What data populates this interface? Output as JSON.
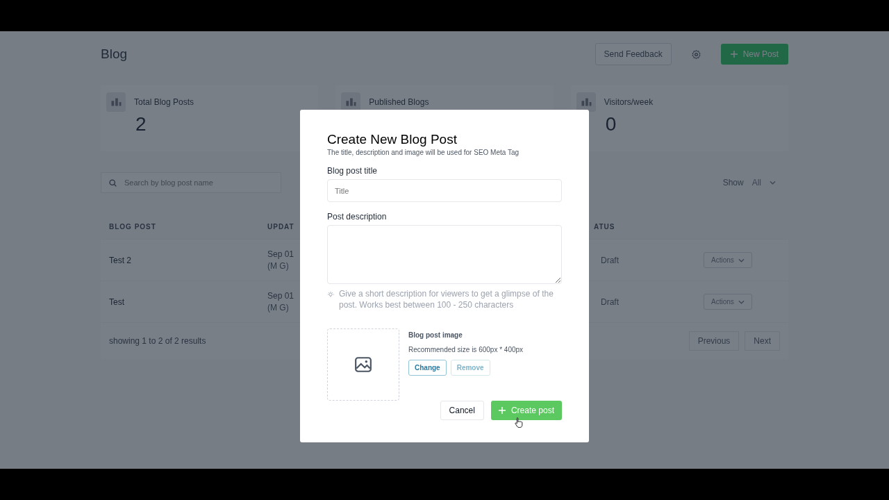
{
  "header": {
    "title": "Blog",
    "feedback_button": "Send Feedback",
    "new_post_button": "New Post"
  },
  "stats": [
    {
      "label": "Total Blog Posts",
      "value": "2"
    },
    {
      "label": "Published Blogs"
    },
    {
      "label": "Visitors/week",
      "value": "0"
    }
  ],
  "search": {
    "placeholder": "Search by blog post name"
  },
  "filter": {
    "label": "Show",
    "value": "All"
  },
  "table": {
    "columns": [
      "BLOG POST",
      "UPDAT",
      "ATUS"
    ],
    "rows": [
      {
        "name": "Test 2",
        "updated": "Sep 01",
        "author": "(M G)",
        "status": "Draft",
        "action": "Actions"
      },
      {
        "name": "Test",
        "updated": "Sep 01",
        "author": "(M G)",
        "status": "Draft",
        "action": "Actions"
      }
    ],
    "summary": "showing 1 to 2 of 2 results",
    "pagination": [
      "Previous",
      "Next"
    ]
  },
  "modal": {
    "title": "Create New Blog Post",
    "subtitle": "The title, description and image will be used for SEO Meta Tag",
    "title_label": "Blog post title",
    "title_placeholder": "Title",
    "description_label": "Post description",
    "hint": "Give a short description for viewers to get a glimpse of the post. Works best between 100 - 250 characters",
    "image_label": "Blog post image",
    "image_size": "Recommended size is 600px * 400px",
    "image_buttons": [
      {
        "label": "Change",
        "disabled": false
      },
      {
        "label": "Remove",
        "disabled": true
      }
    ],
    "cancel": "Cancel",
    "submit": "Create post"
  }
}
